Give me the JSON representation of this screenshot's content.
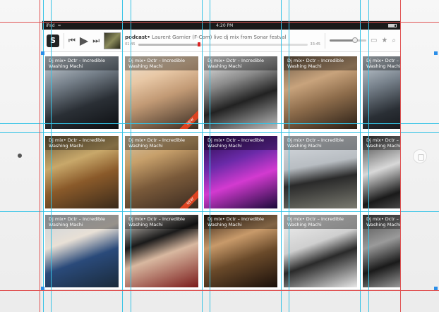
{
  "status_bar": {
    "carrier": "iPad",
    "time": "4:20 PM"
  },
  "player": {
    "logo_letter": "S",
    "track_prefix": "podcast",
    "track_title": "Laurent Garnier (F-Com) live dj mix from Sonar festval",
    "elapsed": "01:45",
    "remaining": "33:45",
    "progress_fraction": 0.36,
    "volume_fraction": 0.7,
    "icons": [
      "rewind-icon",
      "play-icon",
      "fast-forward-icon",
      "airplay-icon",
      "star-icon",
      "search-icon"
    ]
  },
  "tiles": [
    {
      "label": "Dj mix• Dctr – Incredible Washing Machi",
      "bg": "linear-gradient(160deg,#cfd7de 0%,#76808a 35%,#2a2f35 65%,#0d0f12 100%)",
      "badge": ""
    },
    {
      "label": "Dj mix• Dctr – Incredible Washing Machi",
      "bg": "linear-gradient(160deg,#efe6d8 0%,#e8c8a6 30%,#c29a75 55%,#3a2c22 100%)",
      "badge": "NEW"
    },
    {
      "label": "Dj mix• Dctr – Incredible Washing Machi",
      "bg": "linear-gradient(160deg,#f4f4f4 0%,#8a8a8a 35%,#222 60%,#bdbdbd 100%)",
      "badge": ""
    },
    {
      "label": "Dj mix• Dctr – Incredible Washing Machi",
      "bg": "linear-gradient(160deg,#6d5a46 0%,#c8a37c 35%,#8d6c4b 60%,#2a1f16 100%)",
      "badge": ""
    },
    {
      "label": "Dj mix• Dctr – Incredible Washing Machi",
      "bg": "linear-gradient(160deg,#cfd7de 0%,#76808a 35%,#2a2f35 65%,#0d0f12 100%)",
      "badge": ""
    },
    {
      "label": "Dj mix• Dctr – Incredible Washing Machi",
      "bg": "linear-gradient(160deg,#6b5a3a 0%,#c8a86a 35%,#8a5a2a 60%,#3a2a1a 100%)",
      "badge": ""
    },
    {
      "label": "Dj mix• Dctr – Incredible Washing Machi",
      "bg": "linear-gradient(160deg,#d8c6a8 0%,#c7a06b 30%,#7a5a3a 60%,#3a2a20 100%)",
      "badge": "NEW"
    },
    {
      "label": "Dj mix• Dctr – Incredible Washing Machi",
      "bg": "linear-gradient(160deg,#2a0a4a 0%,#6a2aa8 35%,#d33ad0 60%,#1a0a3a 100%)",
      "badge": ""
    },
    {
      "label": "Dj mix• Dctr – Incredible Washing Machi",
      "bg": "linear-gradient(170deg,#d9dde2 0%,#b8bdc2 40%,#2a2a2a 60%,#7a7a70 100%)",
      "badge": ""
    },
    {
      "label": "Dj mix• Dctr – Incredible Washing Machi",
      "bg": "linear-gradient(160deg,#3a3a3a 0%,#d8d8d8 40%,#1a1a1a 70%,#6a6a6a 100%)",
      "badge": ""
    },
    {
      "label": "Dj mix• Dctr – Incredible Washing Machi",
      "bg": "linear-gradient(160deg,#c9d3dc 0%,#e8e0d6 35%,#2a4a7a 60%,#1a2a3a 100%)",
      "badge": ""
    },
    {
      "label": "Dj mix• Dctr – Incredible Washing Machi",
      "bg": "linear-gradient(160deg,#f0e8e0 0%,#1a1a1a 35%,#d8b8a0 55%,#7a1a1a 100%)",
      "badge": ""
    },
    {
      "label": "Dj mix• Dctr – Incredible Washing Machi",
      "bg": "linear-gradient(160deg,#2a1a10 0%,#c89a6a 35%,#6a4a2a 60%,#1a0f0a 100%)",
      "badge": ""
    },
    {
      "label": "Dj mix• Dctr – Incredible Washing Machi",
      "bg": "linear-gradient(160deg,#f2f2f2 0%,#cfcfcf 40%,#2a2a2a 60%,#e8e8e8 100%)",
      "badge": ""
    },
    {
      "label": "Dj mix• Dctr – Incredible Washing Machi",
      "bg": "linear-gradient(160deg,#4a4a4a 0%,#9a9a9a 35%,#1a1a1a 60%,#d8d8d8 100%)",
      "badge": ""
    }
  ],
  "colors": {
    "guide": "#35c3e6",
    "guide_red": "#e05252",
    "handle": "#2b8ee8",
    "progress_knob": "#dd2222"
  }
}
